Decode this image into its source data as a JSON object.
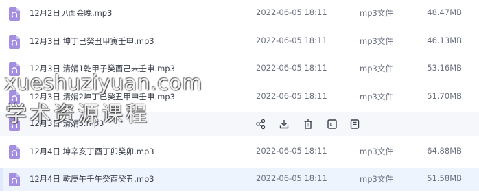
{
  "colors": {
    "icon_bg": "#a38ee0",
    "hover_row": "#f5f7fb",
    "selected_row": "#eef4fe",
    "text_primary": "#3a3f4b",
    "text_secondary": "#6b7180"
  },
  "files": [
    {
      "name": "12月2日见面会晚.mp3",
      "time": "2022-06-05 18:11",
      "type": "mp3文件",
      "size": "48.47MB",
      "icon": "audio-file-icon"
    },
    {
      "name": "12月3日 坤丁巳癸丑甲寅壬申.mp3",
      "time": "2022-06-05 18:11",
      "type": "mp3文件",
      "size": "46.13MB",
      "icon": "audio-file-icon"
    },
    {
      "name": "12月3日 清娟1乾甲子癸酉己未壬申.mp3",
      "time": "2022-06-05 18:11",
      "type": "mp3文件",
      "size": "53.16MB",
      "icon": "audio-file-icon"
    },
    {
      "name": "12月3日 清娟2坤丁巳癸丑甲申壬申.mp3",
      "time": "2022-06-05 18:11",
      "type": "mp3文件",
      "size": "51.70MB",
      "icon": "audio-file-icon"
    },
    {
      "name": "12月3日 清娟3.mp3",
      "time": "",
      "type": "",
      "size": "",
      "icon": "audio-file-icon",
      "actions": [
        "share-icon",
        "download-icon",
        "delete-icon",
        "rename-icon",
        "more-icon"
      ]
    },
    {
      "name": "12月4日 坤辛亥丁酉丁卯癸卯.mp3",
      "time": "2022-06-05 18:11",
      "type": "mp3文件",
      "size": "64.88MB",
      "icon": "audio-file-icon"
    },
    {
      "name": "12月4日 乾庚午壬午癸酉癸丑.mp3",
      "time": "2022-06-05 18:11",
      "type": "mp3文件",
      "size": "51.58MB",
      "icon": "audio-file-icon"
    }
  ],
  "watermark": {
    "line1": "xueshuziyuan.com",
    "line2": "学术资源课程"
  }
}
